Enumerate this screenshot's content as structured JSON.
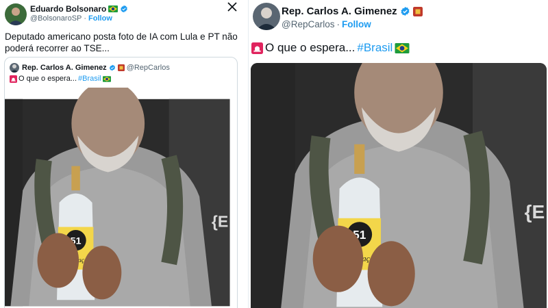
{
  "left_tweet": {
    "author_name": "Eduardo Bolsonaro",
    "author_handle": "@BolsonaroSP",
    "separator": "·",
    "follow_label": "Follow",
    "text": "Deputado americano posta foto de IA com Lula e PT não poderá recorrer ao TSE...",
    "icons": [
      "brazil-flag-icon",
      "verified-badge-icon",
      "x-logo-icon"
    ],
    "quoted_tweet": {
      "author_name": "Rep. Carlos A. Gimenez",
      "author_handle": "@RepCarlos",
      "text": "O que o espera... ",
      "hashtag": "#Brasil",
      "icons": [
        "siren-icon",
        "verified-badge-icon",
        "congress-seal-icon",
        "brazil-flag-icon"
      ]
    }
  },
  "right_tweet": {
    "author_name": "Rep. Carlos A. Gimenez",
    "author_handle": "@RepCarlos",
    "separator": "·",
    "follow_label": "Follow",
    "text": "O que o espera... ",
    "hashtag": "#Brasil",
    "icons": [
      "verified-badge-icon",
      "congress-seal-icon",
      "siren-icon",
      "brazil-flag-icon"
    ]
  },
  "image": {
    "bottle_number": "51",
    "bottle_label": "Cachaça"
  },
  "colors": {
    "accent": "#1d9bf0",
    "text": "#0f1419",
    "muted": "#536471",
    "border": "#cfd9de",
    "seal": "#c0392b",
    "siren": "#e0245e"
  }
}
